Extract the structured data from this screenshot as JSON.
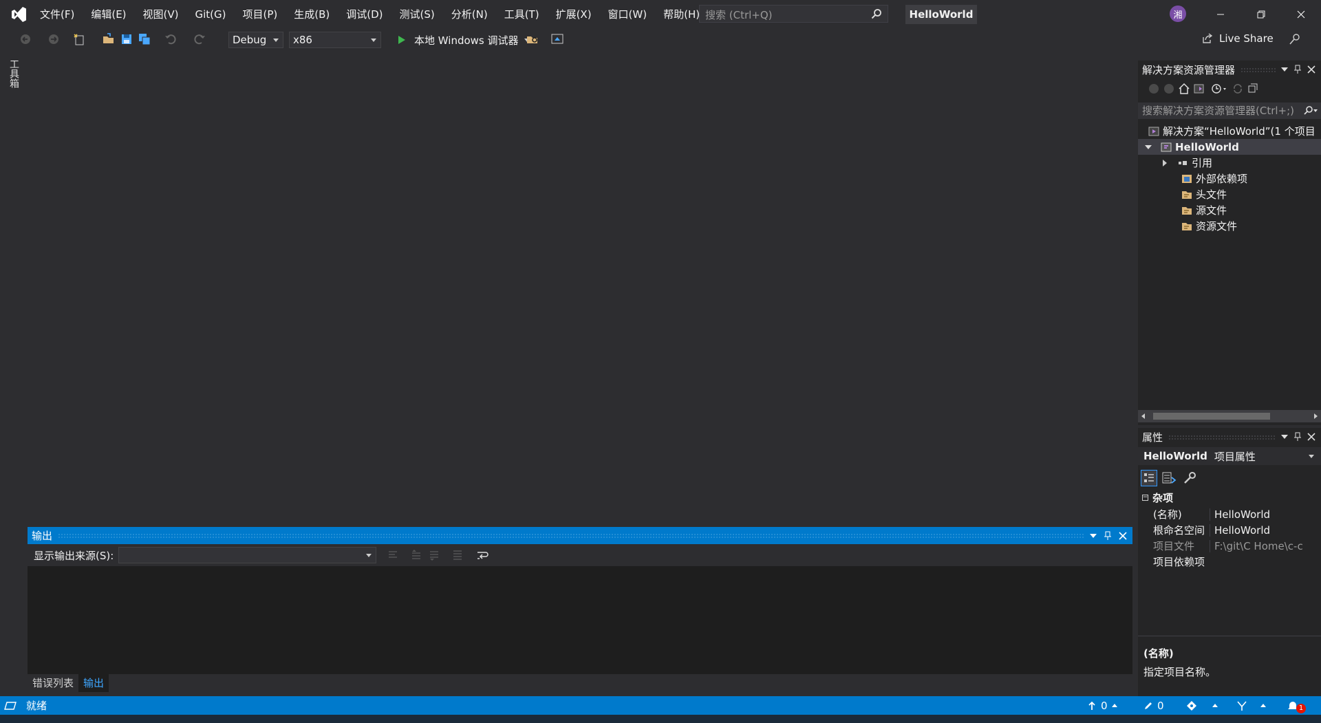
{
  "menu": [
    "文件(F)",
    "编辑(E)",
    "视图(V)",
    "Git(G)",
    "项目(P)",
    "生成(B)",
    "调试(D)",
    "测试(S)",
    "分析(N)",
    "工具(T)",
    "扩展(X)",
    "窗口(W)",
    "帮助(H)"
  ],
  "search": {
    "placeholder": "搜索 (Ctrl+Q)"
  },
  "window_title": "HelloWorld",
  "user_avatar": "湘",
  "toolbar": {
    "config": "Debug",
    "platform": "x86",
    "start_label": "本地 Windows 调试器",
    "live_share": "Live Share"
  },
  "toolbox_tab": "工具箱",
  "solution_explorer": {
    "title": "解决方案资源管理器",
    "search_placeholder": "搜索解决方案资源管理器(Ctrl+;)",
    "tree": [
      {
        "label": "解决方案“HelloWorld”(1 个项目",
        "level": 0
      },
      {
        "label": "HelloWorld",
        "level": 1,
        "selected": true
      },
      {
        "label": "引用",
        "level": 2
      },
      {
        "label": "外部依赖项",
        "level": 2
      },
      {
        "label": "头文件",
        "level": 2
      },
      {
        "label": "源文件",
        "level": 2
      },
      {
        "label": "资源文件",
        "level": 2
      }
    ]
  },
  "properties": {
    "title": "属性",
    "object_name": "HelloWorld",
    "object_type": "项目属性",
    "category": "杂项",
    "rows": [
      {
        "key": "(名称)",
        "value": "HelloWorld"
      },
      {
        "key": "根命名空间",
        "value": "HelloWorld"
      },
      {
        "key": "项目文件",
        "value": "F:\\git\\C Home\\c-c"
      },
      {
        "key": "项目依赖项",
        "value": ""
      }
    ],
    "desc_title": "(名称)",
    "desc_text": "指定项目名称。"
  },
  "output": {
    "title": "输出",
    "source_label": "显示输出来源(S):"
  },
  "bottom_tabs": [
    "错误列表",
    "输出"
  ],
  "status": {
    "ready": "就绪",
    "up_count": "0",
    "edit_count": "0",
    "notifications": "1"
  },
  "colors": {
    "accent": "#007acc",
    "background": "#2d2d30",
    "panel": "#252526"
  }
}
